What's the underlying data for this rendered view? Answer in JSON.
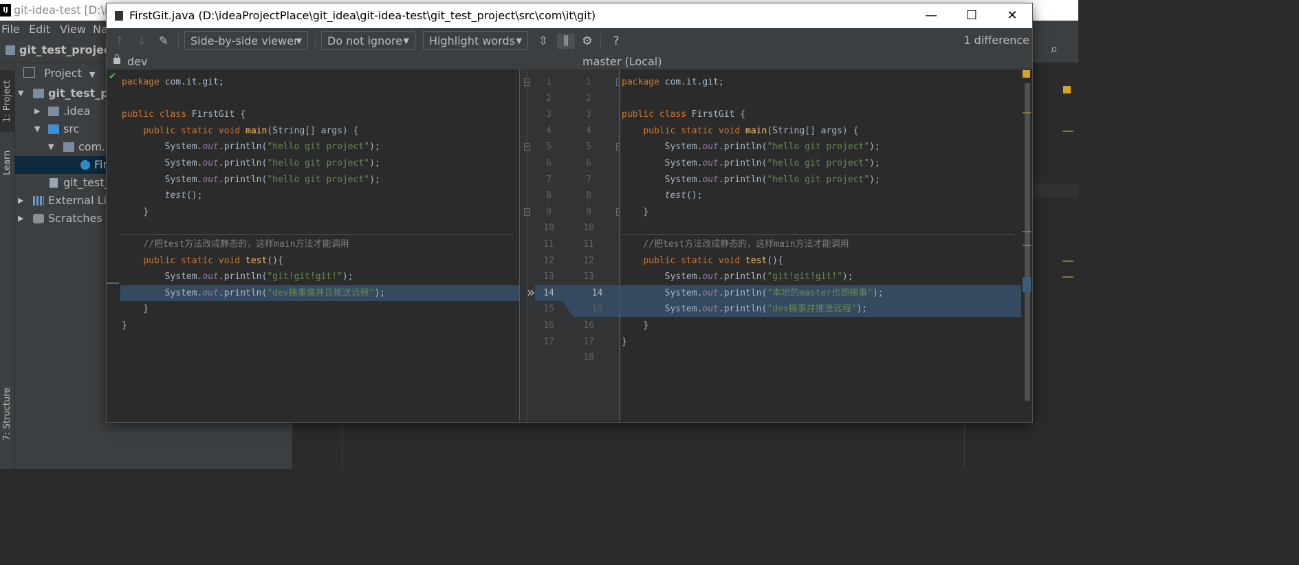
{
  "background_ide": {
    "window_title": "git-idea-test [D:\\id",
    "logo_text": "IJ",
    "menu": [
      "File",
      "Edit",
      "View",
      "Na"
    ],
    "project_name": "git_test_project",
    "vertical_tabs": [
      "1: Project",
      "Learn",
      "7: Structure"
    ],
    "project_panel": {
      "header": "Project",
      "tree": [
        {
          "label": "git_test_proj",
          "icon": "module-folder-icon"
        },
        {
          "label": ".idea",
          "icon": "folder-icon"
        },
        {
          "label": "src",
          "icon": "source-folder-icon"
        },
        {
          "label": "com.i",
          "icon": "package-icon"
        },
        {
          "label": "Fir",
          "icon": "java-class-icon"
        },
        {
          "label": "git_test_",
          "icon": "iml-file-icon"
        },
        {
          "label": "External Lib",
          "icon": "library-icon"
        },
        {
          "label": "Scratches ar",
          "icon": "scratches-icon"
        }
      ]
    }
  },
  "dialog": {
    "title": "FirstGit.java (D:\\ideaProjectPlace\\git_idea\\git-idea-test\\git_test_project\\src\\com\\it\\git)",
    "window_buttons": {
      "minimize": "—",
      "maximize": "☐",
      "close": "✕"
    },
    "toolbar": {
      "viewer": "Side-by-side viewer",
      "ignore": "Do not ignore",
      "highlight": "Highlight words",
      "help": "?",
      "difference_count": "1 difference"
    },
    "left_header": "dev",
    "right_header": "master (Local)",
    "left_line_numbers": [
      "1",
      "2",
      "3",
      "4",
      "5",
      "6",
      "7",
      "8",
      "9",
      "10",
      "11",
      "12",
      "13",
      "14",
      "15",
      "16",
      "17"
    ],
    "right_line_numbers": [
      "1",
      "2",
      "3",
      "4",
      "5",
      "6",
      "7",
      "8",
      "9",
      "10",
      "11",
      "12",
      "13",
      "14",
      "15",
      "16",
      "17",
      "18"
    ],
    "left_code": [
      "package com.it.git;",
      "",
      "public class FirstGit {",
      "    public static void main(String[] args) {",
      "        System.out.println(\"hello git project\");",
      "        System.out.println(\"hello git project\");",
      "        System.out.println(\"hello git project\");",
      "        test();",
      "    }",
      "",
      "    //把test方法改成静态的，这样main方法才能调用",
      "    public static void test(){",
      "        System.out.println(\"git!git!git!\");",
      "        System.out.println(\"dev搞事情并且推送远程\");",
      "    }",
      "}",
      ""
    ],
    "right_code": [
      "package com.it.git;",
      "",
      "public class FirstGit {",
      "    public static void main(String[] args) {",
      "        System.out.println(\"hello git project\");",
      "        System.out.println(\"hello git project\");",
      "        System.out.println(\"hello git project\");",
      "        test();",
      "    }",
      "",
      "    //把test方法改成静态的，这样main方法才能调用",
      "    public static void test(){",
      "        System.out.println(\"git!git!git!\");",
      "        System.out.println(\"本地的master也想搞事\");",
      "        System.out.println(\"dev搞事并推送远程\");",
      "    }",
      "}",
      ""
    ],
    "apply_arrow": "»",
    "colors": {
      "change_background": "#354a5e",
      "keyword": "#cc7832",
      "string": "#6a8759",
      "comment": "#808080"
    }
  }
}
